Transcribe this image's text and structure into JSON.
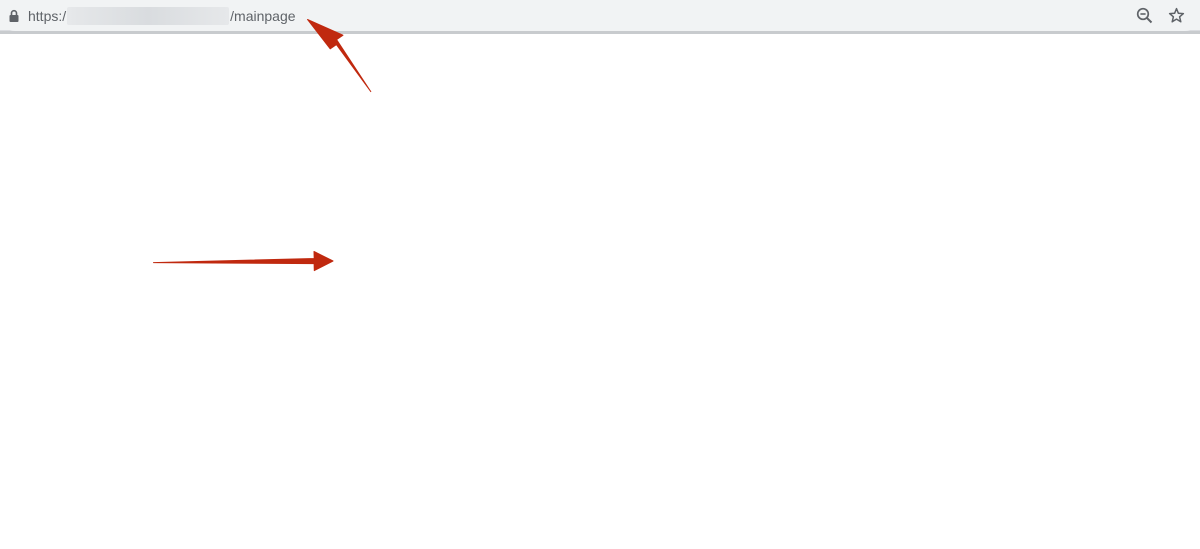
{
  "browser": {
    "address_bar": {
      "scheme_text": "https:/",
      "path_text": "/mainpage"
    },
    "icons": {
      "lock": "lock-icon",
      "zoom": "zoom-out-icon",
      "bookmark": "star-icon"
    }
  },
  "annotations": {
    "arrow_color": "#c0290f"
  }
}
